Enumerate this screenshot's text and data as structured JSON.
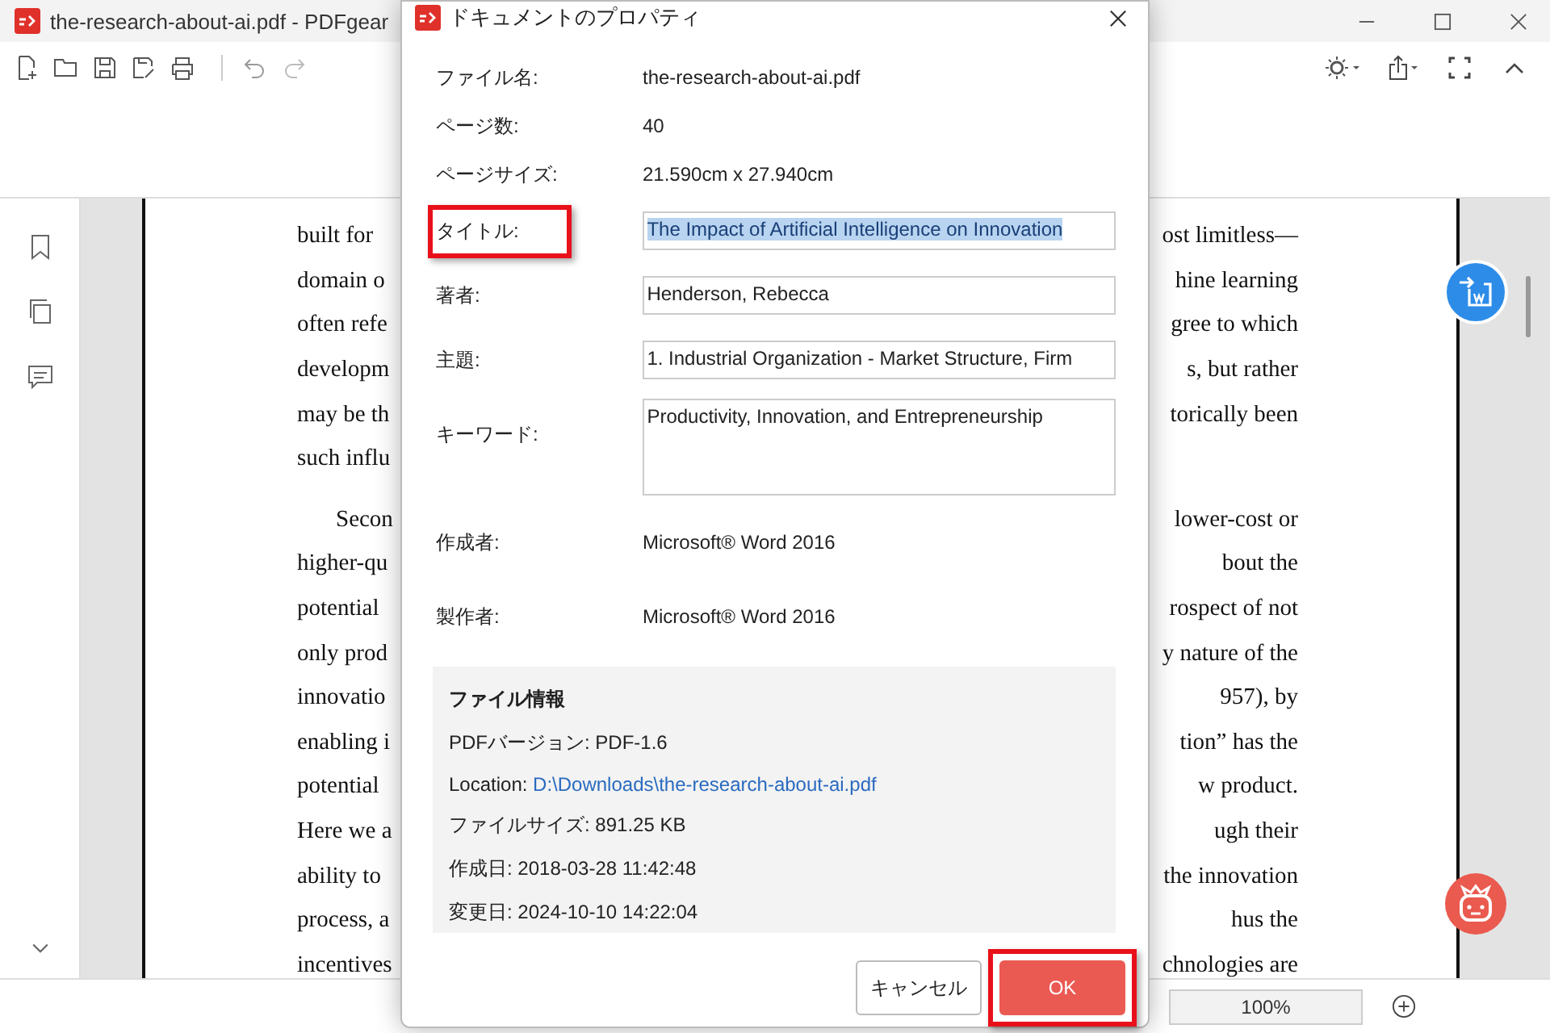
{
  "window": {
    "title": "the-research-about-ai.pdf - PDFgear"
  },
  "document": {
    "paragraphs": [
      {
        "lines": [
          {
            "left": "built for",
            "right": "ost limitless—"
          },
          {
            "left": "domain o",
            "right": "hine learning"
          },
          {
            "left": "often refe",
            "right": "gree to which"
          },
          {
            "left": "developm",
            "right": "s, but rather"
          },
          {
            "left": "may be th",
            "right": "torically been"
          },
          {
            "left": "such influ"
          }
        ]
      },
      {
        "lines": [
          {
            "left": "Secon",
            "right": "lower-cost or"
          },
          {
            "left": "higher-qu",
            "right": "bout the"
          },
          {
            "left": "potential",
            "right": "rospect of not"
          },
          {
            "left": "only prod",
            "right": "y nature of the"
          },
          {
            "left": "innovatio",
            "right": "957), by"
          },
          {
            "left": "enabling i",
            "right": "tion” has the"
          },
          {
            "left": "potential",
            "right": "w product."
          },
          {
            "left": "Here we a",
            "right": "ugh their"
          },
          {
            "left": "ability to",
            "right": "the innovation"
          },
          {
            "left": "process, a",
            "right": "hus the"
          },
          {
            "left": "incentives",
            "right": "chnologies are"
          }
        ]
      }
    ]
  },
  "status_bar": {
    "zoom": "100%"
  },
  "dialog": {
    "title": "ドキュメントのプロパティ",
    "properties": [
      {
        "kind": "text",
        "label": "ファイル名:",
        "value": "the-research-about-ai.pdf",
        "highlighted": false
      },
      {
        "kind": "text",
        "label": "ページ数:",
        "value": "40",
        "highlighted": false
      },
      {
        "kind": "text",
        "label": "ページサイズ:",
        "value": "21.590cm x 27.940cm",
        "highlighted": false
      },
      {
        "kind": "input",
        "label": "タイトル:",
        "value": "The Impact of Artificial Intelligence on Innovation",
        "selected": true,
        "highlighted": true
      },
      {
        "kind": "input",
        "label": "著者:",
        "value": "Henderson, Rebecca",
        "selected": false,
        "highlighted": false
      },
      {
        "kind": "input",
        "label": "主題:",
        "value": "1. Industrial Organization - Market Structure, Firm",
        "selected": false,
        "highlighted": false
      },
      {
        "kind": "textarea",
        "label": "キーワード:",
        "value": "Productivity, Innovation, and Entrepreneurship",
        "selected": false,
        "highlighted": false
      },
      {
        "kind": "text",
        "label": "作成者:",
        "value": "Microsoft® Word 2016",
        "highlighted": false
      },
      {
        "kind": "text",
        "label": "製作者:",
        "value": "Microsoft® Word 2016",
        "highlighted": false
      }
    ],
    "file_info": {
      "heading": "ファイル情報",
      "items": [
        {
          "kind": "text",
          "label": "PDFバージョン:",
          "value": "PDF-1.6"
        },
        {
          "kind": "link",
          "label": "Location:",
          "value": "D:\\Downloads\\the-research-about-ai.pdf"
        },
        {
          "kind": "text",
          "label": "ファイルサイズ:",
          "value": "891.25 KB"
        },
        {
          "kind": "text",
          "label": "作成日:",
          "value": "2018-03-28 11:42:48"
        },
        {
          "kind": "text",
          "label": "変更日:",
          "value": "2024-10-10 14:22:04"
        }
      ]
    },
    "buttons": [
      {
        "kind": "secondary",
        "label": "キャンセル",
        "highlighted": false
      },
      {
        "kind": "primary",
        "label": "OK",
        "highlighted": true
      }
    ]
  }
}
